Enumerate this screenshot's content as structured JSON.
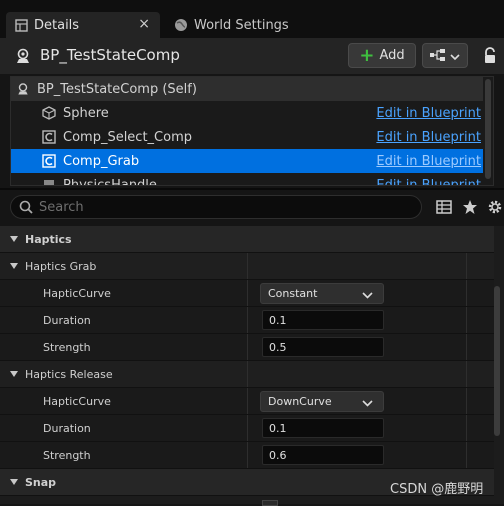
{
  "tabs": {
    "details": "Details",
    "close": "×",
    "world_settings": "World Settings"
  },
  "header": {
    "title": "BP_TestStateComp",
    "add_label": "Add"
  },
  "tree": {
    "items": [
      {
        "label": "BP_TestStateComp (Self)",
        "edit": "",
        "icon": "actor-icon"
      },
      {
        "label": "Sphere",
        "edit": "Edit in Blueprint",
        "icon": "cube-icon"
      },
      {
        "label": "Comp_Select_Comp",
        "edit": "Edit in Blueprint",
        "icon": "component-icon"
      },
      {
        "label": "Comp_Grab",
        "edit": "Edit in Blueprint",
        "icon": "component-icon"
      },
      {
        "label": "PhysicsHandle",
        "edit": "Edit in Blueprint",
        "icon": "physics-icon"
      }
    ]
  },
  "search": {
    "placeholder": "Search"
  },
  "properties": {
    "haptics": "Haptics",
    "haptics_grab": {
      "label": "Haptics Grab",
      "haptic_curve_label": "HapticCurve",
      "haptic_curve_value": "Constant",
      "duration_label": "Duration",
      "duration_value": "0.1",
      "strength_label": "Strength",
      "strength_value": "0.5"
    },
    "haptics_release": {
      "label": "Haptics Release",
      "haptic_curve_label": "HapticCurve",
      "haptic_curve_value": "DownCurve",
      "duration_label": "Duration",
      "duration_value": "0.1",
      "strength_label": "Strength",
      "strength_value": "0.6"
    },
    "snap": "Snap"
  },
  "watermark": "CSDN @鹿野明",
  "colors": {
    "selection": "#0070e0",
    "link": "#4aa3ff",
    "add_plus": "#3fbf3f"
  }
}
